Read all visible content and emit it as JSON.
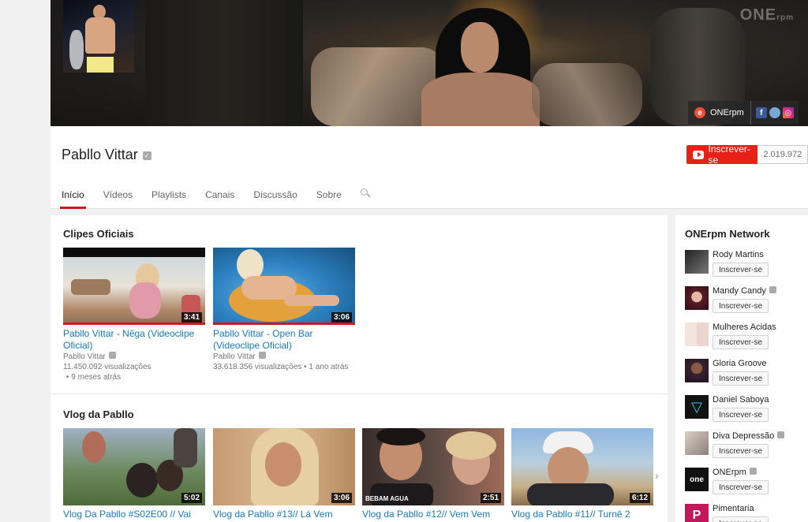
{
  "banner": {
    "watermark": "ONE",
    "watermark_sub": "rpm",
    "link_label": "ONErpm",
    "link_icon": "e-icon",
    "social": [
      "facebook-icon",
      "globe-icon",
      "instagram-icon"
    ]
  },
  "channel": {
    "name": "Pabllo Vittar",
    "subscribe_label": "Inscrever-se",
    "subscriber_count": "2.019.972"
  },
  "tabs": [
    "Início",
    "Vídeos",
    "Playlists",
    "Canais",
    "Discussão",
    "Sobre"
  ],
  "sections": [
    {
      "title": "Clipes Oficiais",
      "videos": [
        {
          "title": "Pabllo Vittar - Nêga (Videoclipe Oficial)",
          "channel": "Pabllo Vittar",
          "views": "11.450.092 visualizações",
          "age": "• 9 meses atrás",
          "duration": "3:41"
        },
        {
          "title": "Pabllo Vittar - Open Bar (Videoclipe Oficial)",
          "channel": "Pabllo Vittar",
          "views": "33.618.356 visualizações",
          "age": "• 1 ano atrás",
          "duration": "3:06"
        }
      ]
    },
    {
      "title": "Vlog da Pabllo",
      "videos": [
        {
          "title": "Vlog Da Pabllo #S02E00 // Vai",
          "duration": "5:02"
        },
        {
          "title": "Vlog da Pabllo #13// Lá Vem",
          "duration": "3:06"
        },
        {
          "title": "Vlog da Pabllo #12// Vem Vem",
          "duration": "2:51",
          "caption": "BEBAM AGUA"
        },
        {
          "title": "Vlog da Pabllo #11// Turnê 2",
          "duration": "6:12"
        }
      ]
    }
  ],
  "sidebar": {
    "title": "ONErpm Network",
    "button_label": "Inscrever-se",
    "channels": [
      {
        "name": "Rody Martins",
        "verified": false
      },
      {
        "name": "Mandy Candy",
        "verified": true
      },
      {
        "name": "Mulheres Acidas",
        "verified": false
      },
      {
        "name": "Gloria Groove",
        "verified": false
      },
      {
        "name": "Daniel Saboya",
        "verified": false
      },
      {
        "name": "Diva Depressão",
        "verified": true
      },
      {
        "name": "ONErpm",
        "verified": true
      },
      {
        "name": "Pimentaria",
        "verified": false
      }
    ]
  },
  "colors": {
    "accent": "#cc181e",
    "subscribe": "#e62117",
    "link": "#167ac6"
  }
}
